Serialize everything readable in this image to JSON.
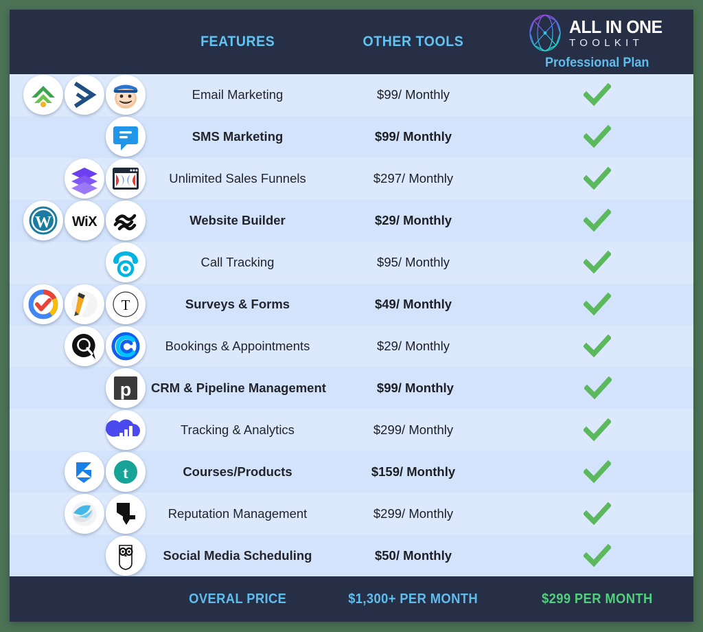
{
  "header": {
    "features_label": "FEATURES",
    "other_tools_label": "OTHER TOOLS",
    "brand_line1": "ALL IN ONE",
    "brand_line2": "TOOLKIT",
    "plan_label": "Professional Plan"
  },
  "colors": {
    "page_background": "#4c7356",
    "card_header": "#272f47",
    "row_odd": "#dce9fc",
    "row_even": "#d3e3fb",
    "accent_blue": "#5fbdee",
    "accent_green": "#4fd07a",
    "check_green": "#5cb85c"
  },
  "rows": [
    {
      "feature": "Email Marketing",
      "price": "$99/ Monthly",
      "included": true,
      "bold": false,
      "logos": [
        "constant-contact-icon",
        "activecampaign-icon",
        "mailchimp-icon"
      ]
    },
    {
      "feature": "SMS Marketing",
      "price": "$99/ Monthly",
      "included": true,
      "bold": true,
      "logos": [
        "simpletexting-icon"
      ]
    },
    {
      "feature": "Unlimited Sales Funnels",
      "price": "$297/ Monthly",
      "included": true,
      "bold": false,
      "logos": [
        "leadpages-icon",
        "clickfunnels-icon"
      ]
    },
    {
      "feature": "Website Builder",
      "price": "$29/ Monthly",
      "included": true,
      "bold": true,
      "logos": [
        "wordpress-icon",
        "wix-icon",
        "squarespace-icon"
      ]
    },
    {
      "feature": "Call Tracking",
      "price": "$95/ Monthly",
      "included": true,
      "bold": false,
      "logos": [
        "callrail-icon"
      ]
    },
    {
      "feature": "Surveys & Forms",
      "price": "$49/ Monthly",
      "included": true,
      "bold": true,
      "logos": [
        "google-forms-icon",
        "jotform-icon",
        "typeform-icon"
      ]
    },
    {
      "feature": "Bookings & Appointments",
      "price": "$29/ Monthly",
      "included": true,
      "bold": false,
      "logos": [
        "acuity-icon",
        "calendly-icon"
      ]
    },
    {
      "feature": "CRM & Pipeline Management",
      "price": "$99/ Monthly",
      "included": true,
      "bold": true,
      "logos": [
        "pipedrive-icon"
      ]
    },
    {
      "feature": "Tracking & Analytics",
      "price": "$299/ Monthly",
      "included": true,
      "bold": false,
      "logos": [
        "analytics-icon"
      ]
    },
    {
      "feature": "Courses/Products",
      "price": "$159/ Monthly",
      "included": true,
      "bold": true,
      "logos": [
        "kajabi-icon",
        "teachable-icon"
      ]
    },
    {
      "feature": "Reputation Management",
      "price": "$299/ Monthly",
      "included": true,
      "bold": false,
      "logos": [
        "birdeye-icon",
        "yelp-icon"
      ]
    },
    {
      "feature": "Social Media Scheduling",
      "price": "$50/ Monthly",
      "included": true,
      "bold": true,
      "logos": [
        "hootsuite-icon"
      ]
    }
  ],
  "footer": {
    "label": "OVERAL PRICE",
    "other_total": "$1,300+ PER MONTH",
    "plan_total": "$299 PER MONTH"
  }
}
